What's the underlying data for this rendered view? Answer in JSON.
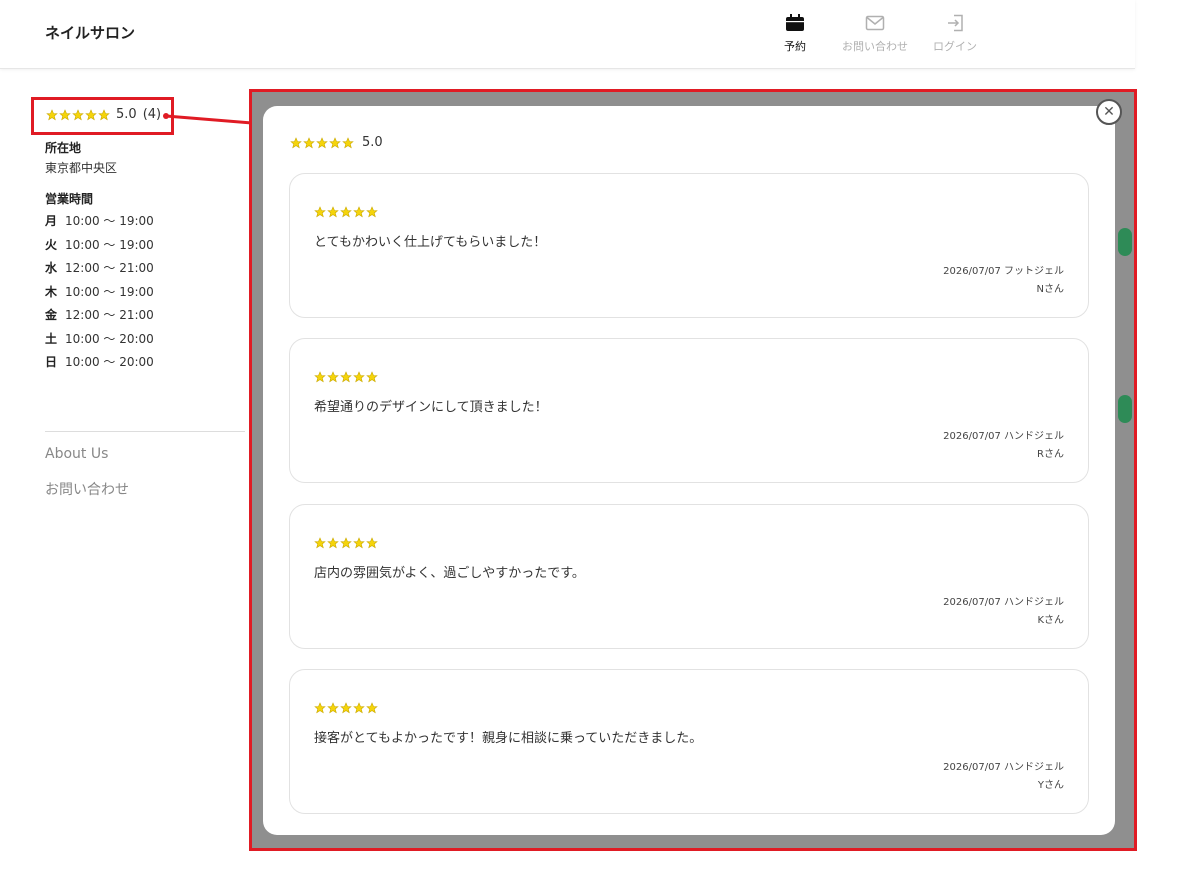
{
  "header": {
    "brand": "ネイルサロン",
    "nav": [
      {
        "label": "予約",
        "icon": "calendar-icon",
        "active": true
      },
      {
        "label": "お問い合わせ",
        "icon": "mail-icon",
        "active": false
      },
      {
        "label": "ログイン",
        "icon": "login-icon",
        "active": false
      }
    ]
  },
  "sidebar": {
    "rating": {
      "score": "5.0",
      "count": "(4)"
    },
    "location_label": "所在地",
    "location_value": "東京都中央区",
    "hours_label": "営業時間",
    "hours": [
      {
        "day": "月",
        "time": "10:00 〜 19:00"
      },
      {
        "day": "火",
        "time": "10:00 〜 19:00"
      },
      {
        "day": "水",
        "time": "12:00 〜 21:00"
      },
      {
        "day": "木",
        "time": "10:00 〜 19:00"
      },
      {
        "day": "金",
        "time": "12:00 〜 21:00"
      },
      {
        "day": "土",
        "time": "10:00 〜 20:00"
      },
      {
        "day": "日",
        "time": "10:00 〜 20:00"
      }
    ],
    "footer_links": [
      "About Us",
      "お問い合わせ"
    ]
  },
  "modal": {
    "score": "5.0",
    "reviews": [
      {
        "text": "とてもかわいく仕上げてもらいました！",
        "date_menu": "2026/07/07 フットジェル",
        "author": "Nさん"
      },
      {
        "text": "希望通りのデザインにして頂きました！",
        "date_menu": "2026/07/07 ハンドジェル",
        "author": "Rさん"
      },
      {
        "text": "店内の雰囲気がよく、過ごしやすかったです。",
        "date_menu": "2026/07/07 ハンドジェル",
        "author": "Kさん"
      },
      {
        "text": "接客がとてもよかったです！親身に相談に乗っていただきました。",
        "date_menu": "2026/07/07 ハンドジェル",
        "author": "Yさん"
      }
    ]
  },
  "colors": {
    "star": "#f5d40a",
    "star_stroke": "#c9a800",
    "highlight": "#e01b24",
    "overlay": "#8f8f8f"
  }
}
